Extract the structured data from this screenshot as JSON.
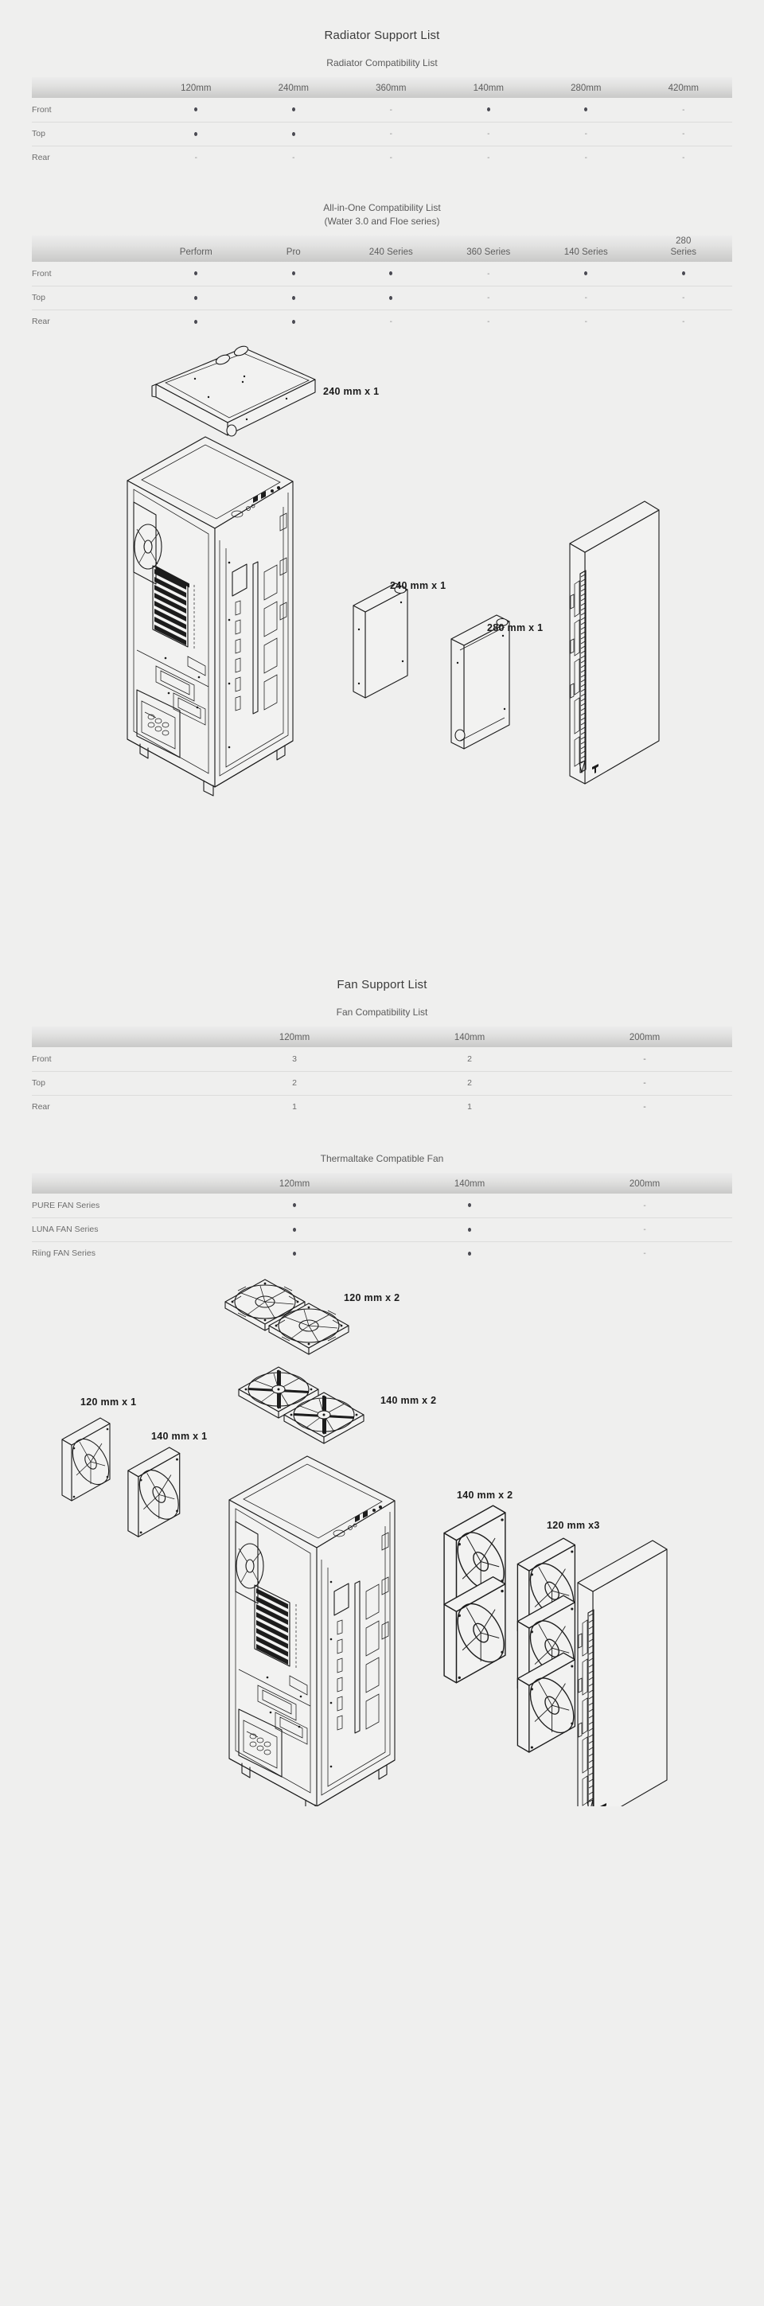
{
  "radiator_section": {
    "title": "Radiator Support List",
    "table1": {
      "caption": "Radiator Compatibility List",
      "columns": [
        "",
        "120mm",
        "240mm",
        "360mm",
        "140mm",
        "280mm",
        "420mm"
      ],
      "rows": [
        {
          "label": "Front",
          "values": [
            "dot",
            "dot",
            "-",
            "dot",
            "dot",
            "-"
          ]
        },
        {
          "label": "Top",
          "values": [
            "dot",
            "dot",
            "-",
            "-",
            "-",
            "-"
          ]
        },
        {
          "label": "Rear",
          "values": [
            "-",
            "-",
            "-",
            "-",
            "-",
            "-"
          ]
        }
      ]
    },
    "table2": {
      "caption_line1": "All-in-One Compatibility List",
      "caption_line2": "(Water 3.0 and Floe series)",
      "columns": [
        "",
        "Perform",
        "Pro",
        "240 Series",
        "360 Series",
        "140 Series",
        "280\nSeries"
      ],
      "columns_display": [
        "",
        "Perform",
        "Pro",
        "240 Series",
        "360 Series",
        "140 Series",
        "280 Series"
      ],
      "rows": [
        {
          "label": "Front",
          "values": [
            "dot",
            "dot",
            "dot",
            "-",
            "dot",
            "dot"
          ]
        },
        {
          "label": "Top",
          "values": [
            "dot",
            "dot",
            "dot",
            "-",
            "-",
            "-"
          ]
        },
        {
          "label": "Rear",
          "values": [
            "dot",
            "dot",
            "-",
            "-",
            "-",
            "-"
          ]
        }
      ]
    },
    "diagram_labels": {
      "top_radiator": "240 mm x 1",
      "front_radiator": "240 mm x 1",
      "front_radiator_2": "280 mm x 1"
    }
  },
  "fan_section": {
    "title": "Fan Support List",
    "table1": {
      "caption": "Fan Compatibility List",
      "columns": [
        "",
        "120mm",
        "140mm",
        "200mm"
      ],
      "rows": [
        {
          "label": "Front",
          "values": [
            "3",
            "2",
            "-"
          ]
        },
        {
          "label": "Top",
          "values": [
            "2",
            "2",
            "-"
          ]
        },
        {
          "label": "Rear",
          "values": [
            "1",
            "1",
            "-"
          ]
        }
      ]
    },
    "table2": {
      "caption": "Thermaltake Compatible Fan",
      "columns": [
        "",
        "120mm",
        "140mm",
        "200mm"
      ],
      "rows": [
        {
          "label": "PURE FAN Series",
          "values": [
            "dot",
            "dot",
            "-"
          ]
        },
        {
          "label": "LUNA FAN Series",
          "values": [
            "dot",
            "dot",
            "-"
          ]
        },
        {
          "label": "Riing FAN Series",
          "values": [
            "dot",
            "dot",
            "-"
          ]
        }
      ]
    },
    "diagram_labels": {
      "top_fans": "120 mm x 2",
      "left_fan_120": "120 mm x 1",
      "left_fan_140": "140 mm x 1",
      "mid_fans_140": "140 mm x 2",
      "front_fans_140": "140 mm x 2",
      "front_fans_120": "120 mm x3"
    }
  },
  "colors": {
    "page_bg": "#efefee",
    "header_grad_top": "#ececec",
    "header_grad_bottom": "#c9c9c8",
    "row_divider": "#dcdcdb",
    "text": "#6d6d6d",
    "title_text": "#3b3b3b",
    "line_art": "#1c1c1c"
  }
}
